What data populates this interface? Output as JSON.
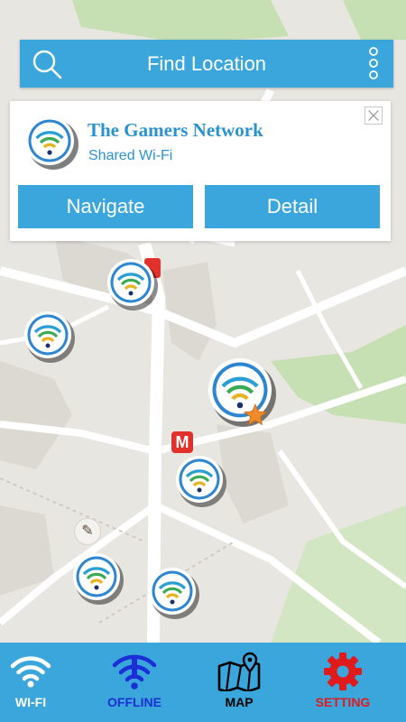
{
  "app": {
    "title": "Find Location"
  },
  "header": {
    "search_icon": "search-icon",
    "menu_icon": "more-vertical-icon"
  },
  "popup": {
    "network_name": "The Gamers Network",
    "network_type": "Shared Wi-Fi",
    "navigate_label": "Navigate",
    "detail_label": "Detail",
    "close_icon": "close-icon"
  },
  "map": {
    "poi_metro_label": "M",
    "markers_count_visible": 7
  },
  "bottom_nav": {
    "items": [
      {
        "label": "WI-FI",
        "icon": "wifi-icon",
        "color": "#ffffff"
      },
      {
        "label": "OFFLINE",
        "icon": "wifi-offline-icon",
        "color": "#1a2fd6"
      },
      {
        "label": "MAP",
        "icon": "map-icon",
        "color": "#000000"
      },
      {
        "label": "SETTING",
        "icon": "gear-icon",
        "color": "#e01b1b"
      }
    ]
  },
  "colors": {
    "accent": "#3aa6dc",
    "popup_text": "#2a92cf",
    "metro_red": "#e2302a",
    "star_orange": "#f0892a"
  }
}
